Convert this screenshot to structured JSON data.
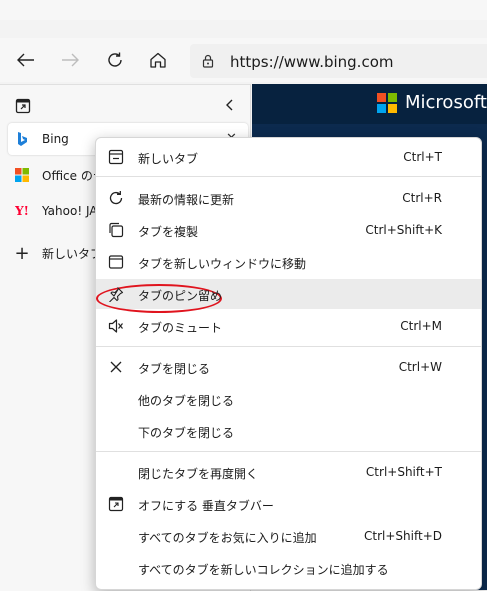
{
  "address_bar": {
    "url": "https://www.bing.com"
  },
  "sidebar": {
    "tabs": [
      {
        "label": "Bing",
        "icon": "bing-icon"
      },
      {
        "label": "Office のテ",
        "icon": "office-icon"
      },
      {
        "label": "Yahoo! JAP",
        "icon": "yahoo-icon"
      }
    ],
    "new_tab_label": "新しいタブ"
  },
  "content": {
    "brand": "Microsoft"
  },
  "menu": {
    "items": [
      {
        "label": "新しいタブ",
        "shortcut": "Ctrl+T",
        "icon": "new-tab-icon"
      },
      {
        "label": "最新の情報に更新",
        "shortcut": "Ctrl+R",
        "icon": "refresh-icon"
      },
      {
        "label": "タブを複製",
        "shortcut": "Ctrl+Shift+K",
        "icon": "duplicate-icon"
      },
      {
        "label": "タブを新しいウィンドウに移動",
        "shortcut": "",
        "icon": "window-icon"
      },
      {
        "label": "タブのピン留め",
        "shortcut": "",
        "icon": "pin-icon"
      },
      {
        "label": "タブのミュート",
        "shortcut": "Ctrl+M",
        "icon": "mute-icon"
      },
      {
        "label": "タブを閉じる",
        "shortcut": "Ctrl+W",
        "icon": "close-icon"
      },
      {
        "label": "他のタブを閉じる",
        "shortcut": "",
        "icon": ""
      },
      {
        "label": "下のタブを閉じる",
        "shortcut": "",
        "icon": ""
      },
      {
        "label": "閉じたタブを再度開く",
        "shortcut": "Ctrl+Shift+T",
        "icon": ""
      },
      {
        "label": "オフにする 垂直タブバー",
        "shortcut": "",
        "icon": "vertical-tabs-icon"
      },
      {
        "label": "すべてのタブをお気に入りに追加",
        "shortcut": "Ctrl+Shift+D",
        "icon": ""
      },
      {
        "label": "すべてのタブを新しいコレクションに追加する",
        "shortcut": "",
        "icon": ""
      }
    ]
  },
  "colors": {
    "highlight_oval": "#e0141e",
    "menu_hover": "#ebebeb",
    "content_bg": "#0c2a4e"
  }
}
